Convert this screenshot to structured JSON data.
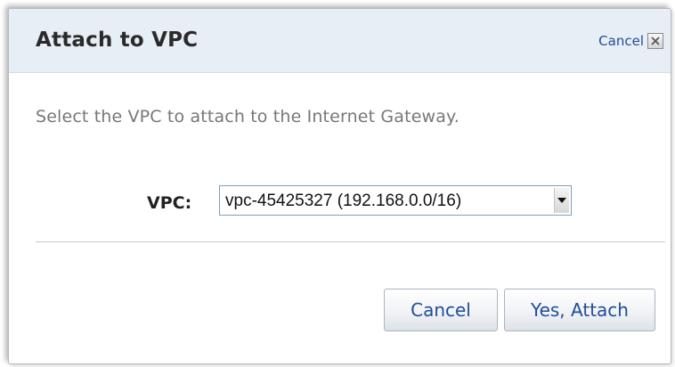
{
  "dialog": {
    "title": "Attach to VPC",
    "header_cancel_label": "Cancel",
    "close_icon": "close-icon",
    "instructions": "Select the VPC to attach to the Internet Gateway.",
    "vpc_field": {
      "label": "VPC:",
      "selected_value": "vpc-45425327 (192.168.0.0/16)",
      "arrow_icon": "chevron-down-icon"
    },
    "buttons": {
      "cancel_label": "Cancel",
      "attach_label": "Yes, Attach"
    }
  },
  "colors": {
    "header_background": "#e8eef6",
    "link_blue": "#1f4d99",
    "muted_text": "#777777"
  }
}
